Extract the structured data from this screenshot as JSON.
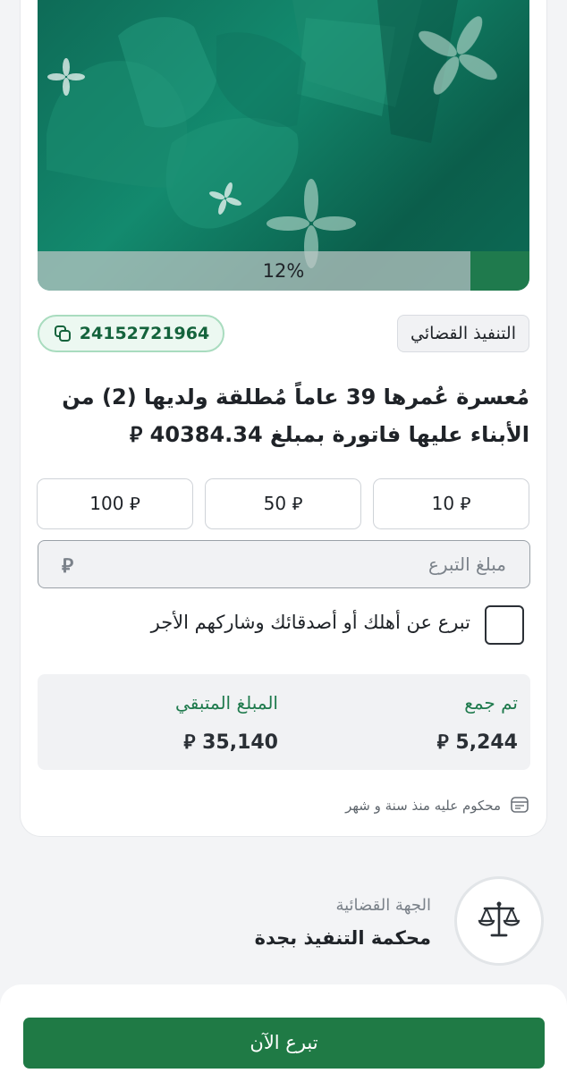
{
  "campaign": {
    "progress_fraction": 0.12,
    "progress_text": "12%",
    "category": "التنفيذ القضائي",
    "case_number": "24152721964",
    "title": "مُعسرة عُمرها 39 عاماً مُطلقة ولديها (2) من الأبناء عليها فاتورة بمبلغ 40384.34 ⃁"
  },
  "currency_symbol": "⃁",
  "preset_amounts": [
    {
      "label": "10 ⃁"
    },
    {
      "label": "50 ⃁"
    },
    {
      "label": "100 ⃁"
    }
  ],
  "donation_input": {
    "placeholder": "مبلغ التبرع",
    "value": ""
  },
  "gift_option": {
    "label": "تبرع عن أهلك أو أصدقائك وشاركهم الأجر",
    "checked": false
  },
  "stats": {
    "collected_label": "تم جمع",
    "collected_value": "5,244 ⃁",
    "remaining_label": "المبلغ المتبقي",
    "remaining_value": "35,140 ⃁"
  },
  "judgment_note": "محكوم عليه منذ سنة و شهر",
  "court": {
    "label": "الجهة القضائية",
    "name": "محكمة التنفيذ بجدة"
  },
  "cta": {
    "label": "تبرع الآن"
  },
  "colors": {
    "primary_green": "#1f7a45",
    "badge_green": "#14633c",
    "hero_teal": "#0e6b57"
  },
  "icons": {
    "copy": "copy-icon",
    "calendar": "calendar-icon",
    "court": "scales-icon"
  }
}
